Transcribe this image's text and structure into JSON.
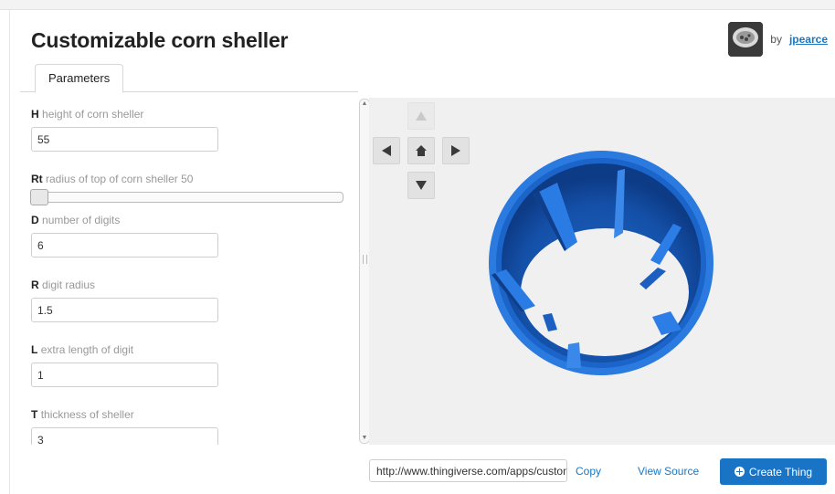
{
  "header": {
    "title": "Customizable corn sheller",
    "by_label": "by",
    "author": "jpearce"
  },
  "tabs": [
    {
      "label": "Parameters"
    }
  ],
  "params": [
    {
      "key": "H",
      "label": "height of corn sheller",
      "value": "55"
    },
    {
      "key": "Rt",
      "label": "radius of top of corn sheller 50",
      "slider_fraction": 0.0
    },
    {
      "key": "D",
      "label": "number of digits",
      "value": "6"
    },
    {
      "key": "R",
      "label": "digit radius",
      "value": "1.5"
    },
    {
      "key": "L",
      "label": "extra length of digit",
      "value": "1"
    },
    {
      "key": "T",
      "label": "thickness of sheller",
      "value": "3"
    }
  ],
  "viewer": {
    "nav_icons": [
      "arrow-up-icon",
      "arrow-left-icon",
      "home-icon",
      "arrow-right-icon",
      "arrow-down-icon"
    ],
    "model_color": "#1f6fd6"
  },
  "footer": {
    "url": "http://www.thingiverse.com/apps/customizer",
    "url_icon": "link-icon",
    "copy_label": "Copy",
    "view_source_label": "View Source",
    "create_label": "Create Thing",
    "create_icon": "plus-circle-icon"
  },
  "colors": {
    "accent": "#1a74c6",
    "link": "#1a78c2"
  }
}
